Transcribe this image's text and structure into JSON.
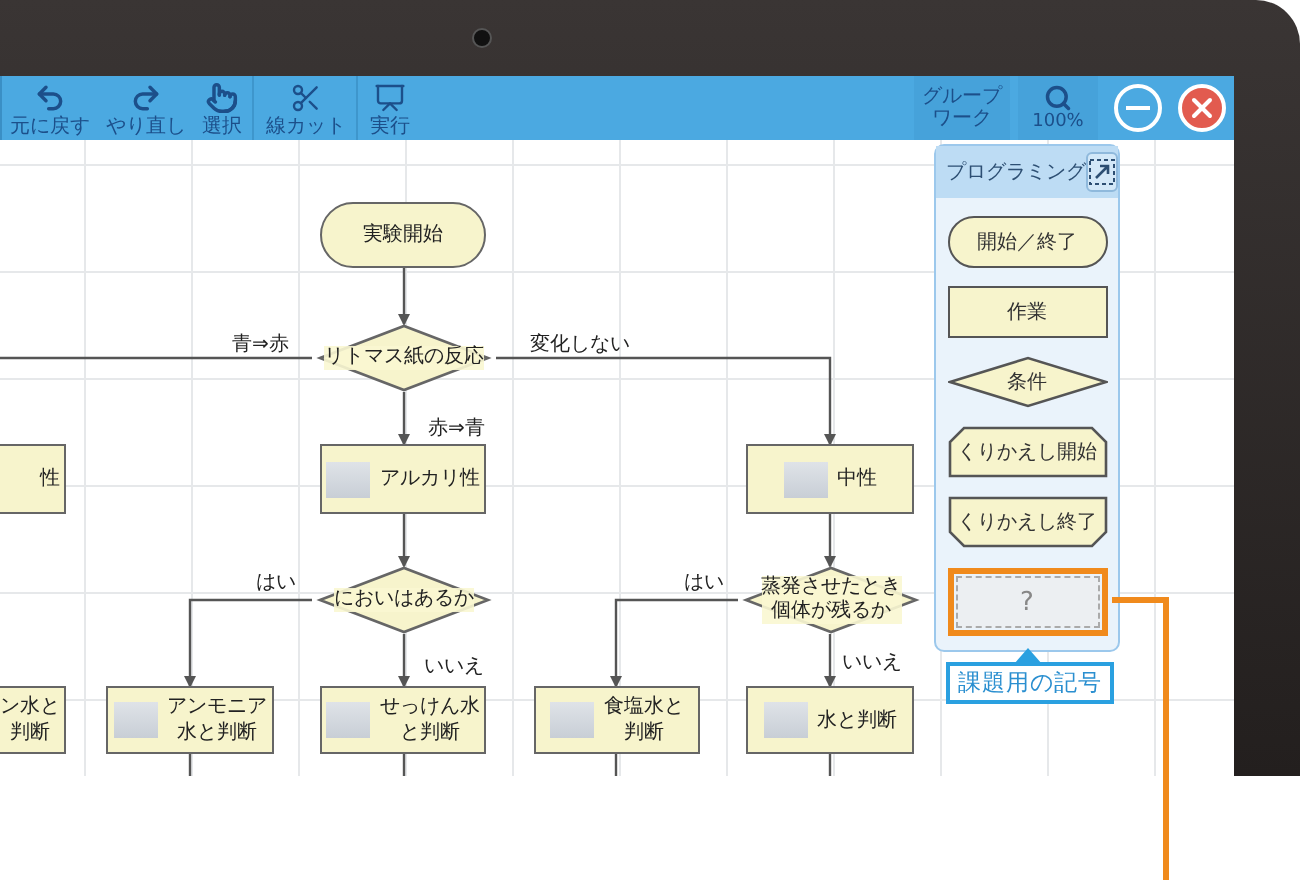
{
  "toolbar": {
    "buttons": [
      {
        "kind": "undo",
        "label": "元に戻す"
      },
      {
        "kind": "redo",
        "label": "やり直し"
      },
      {
        "kind": "select",
        "label": "選択"
      },
      {
        "kind": "cut",
        "label": "線カット"
      },
      {
        "kind": "run",
        "label": "実行"
      }
    ],
    "group_work": [
      "グループ",
      "ワーク"
    ],
    "zoom": "100%"
  },
  "flowchart": {
    "nodes": [
      {
        "kind": "terminal",
        "lines": [
          "実験開始"
        ]
      },
      {
        "kind": "decision",
        "lines": [
          "リトマス紙の反応"
        ]
      },
      {
        "kind": "process",
        "lines": [
          "性"
        ],
        "photo": false
      },
      {
        "kind": "process",
        "lines": [
          "アルカリ性"
        ],
        "photo": true
      },
      {
        "kind": "process",
        "lines": [
          "中性"
        ],
        "photo": true
      },
      {
        "kind": "decision",
        "lines": [
          "においはあるか"
        ]
      },
      {
        "kind": "decision",
        "lines": [
          "蒸発させたとき",
          "個体が残るか"
        ]
      },
      {
        "kind": "process",
        "lines": [
          "ン水と",
          "判断"
        ],
        "photo": false
      },
      {
        "kind": "process",
        "lines": [
          "アンモニア",
          "水と判断"
        ],
        "photo": true
      },
      {
        "kind": "process",
        "lines": [
          "せっけん水",
          "と判断"
        ],
        "photo": true
      },
      {
        "kind": "process",
        "lines": [
          "食塩水と",
          "判断"
        ],
        "photo": true
      },
      {
        "kind": "process",
        "lines": [
          "水と判断"
        ],
        "photo": true
      }
    ],
    "edge_labels": [
      "青⇒赤",
      "変化しない",
      "赤⇒青",
      "はい",
      "いいえ",
      "はい",
      "いいえ"
    ]
  },
  "palette": {
    "title": "プログラミング",
    "items": [
      {
        "kind": "terminal",
        "label": "開始／終了"
      },
      {
        "kind": "process",
        "label": "作業"
      },
      {
        "kind": "decision",
        "label": "条件"
      },
      {
        "kind": "loop_start",
        "label": "くりかえし開始"
      },
      {
        "kind": "loop_end",
        "label": "くりかえし終了"
      },
      {
        "kind": "slot",
        "label": "?"
      }
    ],
    "callout": "課題用の記号"
  }
}
